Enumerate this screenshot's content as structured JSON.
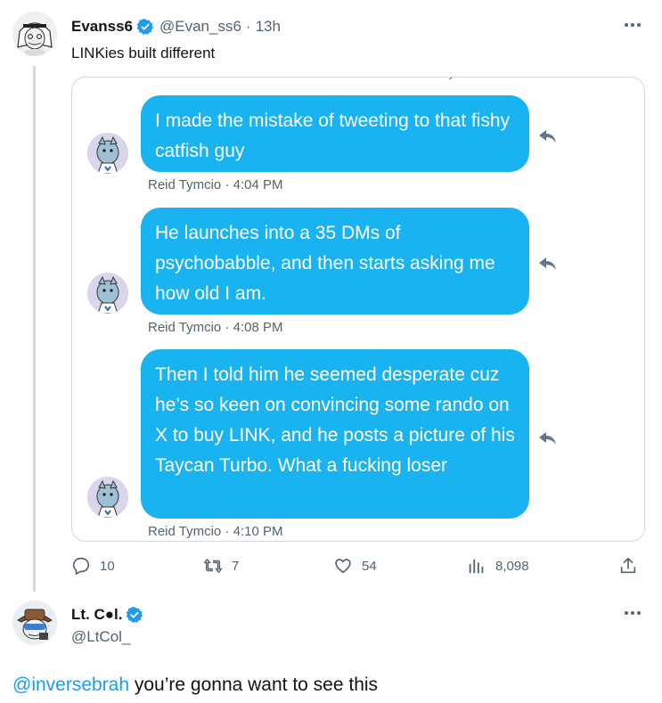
{
  "tweet": {
    "author_name": "Evanss6",
    "handle": "@Evan_ss6",
    "separator": "·",
    "time": "13h",
    "text": "LINKies built different",
    "more_icon": "more-horizontal-icon",
    "verified_color": "#1d9bf0"
  },
  "media": {
    "messages": [
      {
        "text": "I made the mistake of tweeting to that fishy catfish guy",
        "sender": "Reid Tymcio",
        "sep": "·",
        "time": "4:04 PM"
      },
      {
        "text": "He launches into a 35 DMs of psychobabble, and then starts asking me how old I am.",
        "sender": "Reid Tymcio",
        "sep": "·",
        "time": "4:08 PM"
      },
      {
        "text": "Then I told him he seemed desperate cuz he’s so keen on convincing some rando on X to buy LINK, and he posts a picture of his Taycan Turbo. What a fucking loser",
        "sender": "Reid Tymcio",
        "sep": "·",
        "time": "4:10 PM"
      }
    ],
    "bubble_color": "#1ab3f2"
  },
  "actions": {
    "replies": "10",
    "retweets": "7",
    "likes": "54",
    "views": "8,098"
  },
  "reply": {
    "author_name": "Lt. C●l.",
    "handle": "@LtCol_",
    "mention": "@inversebrah",
    "text": " you’re gonna want to see this"
  },
  "colors": {
    "accent": "#1d9bf0",
    "secondary_text": "#536471",
    "border": "#cfd9de"
  }
}
